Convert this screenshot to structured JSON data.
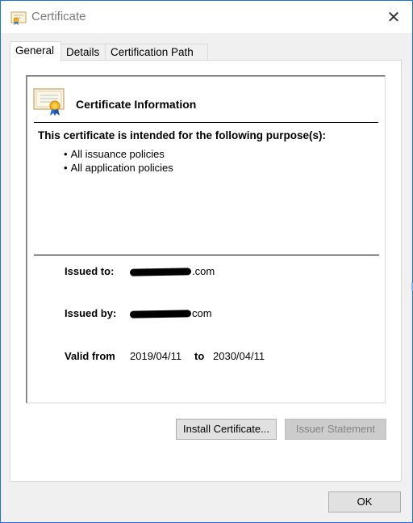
{
  "window": {
    "title": "Certificate",
    "close_glyph": "✕"
  },
  "tabs": [
    {
      "label": "General",
      "active": true
    },
    {
      "label": "Details",
      "active": false
    },
    {
      "label": "Certification Path",
      "active": false
    }
  ],
  "info": {
    "heading": "Certificate Information",
    "purpose_heading": "This certificate is intended for the following purpose(s):",
    "purposes": [
      "All issuance policies",
      "All application policies"
    ],
    "issued_to_label": "Issued to:",
    "issued_to_value_suffix": ".com",
    "issued_by_label": "Issued by:",
    "issued_by_value_suffix": "com",
    "valid_from_label": "Valid from",
    "valid_from": "2019/04/11",
    "valid_to_label": "to",
    "valid_to": "2030/04/11"
  },
  "buttons": {
    "install": "Install Certificate...",
    "issuer_statement": "Issuer Statement",
    "ok": "OK"
  },
  "icons": {
    "title": "certificate-icon",
    "info": "certificate-icon",
    "close": "close-icon"
  },
  "colors": {
    "accent": "#1a73d9",
    "window_bg": "#f0f0f0",
    "disabled_text": "#838383"
  }
}
